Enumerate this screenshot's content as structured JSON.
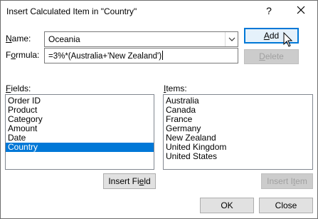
{
  "window": {
    "title": "Insert Calculated Item in \"Country\"",
    "help": "?"
  },
  "form": {
    "name_label_key": "N",
    "name_label_rest": "ame:",
    "name_value": "Oceania",
    "formula_label_pre": "F",
    "formula_label_key": "o",
    "formula_label_rest": "rmula:",
    "formula_value": "=3%*(Australia+'New Zealand')"
  },
  "fields": {
    "label_key": "F",
    "label_rest": "ields:",
    "items": [
      "Order ID",
      "Product",
      "Category",
      "Amount",
      "Date",
      "Country"
    ],
    "selected": "Country"
  },
  "items": {
    "label_key": "I",
    "label_rest": "tems:",
    "items": [
      "Australia",
      "Canada",
      "France",
      "Germany",
      "New Zealand",
      "United Kingdom",
      "United States"
    ]
  },
  "buttons": {
    "add_key": "A",
    "add_rest": "dd",
    "delete_key": "D",
    "delete_rest": "elete",
    "insert_field_pre": "Insert Fi",
    "insert_field_key": "e",
    "insert_field_rest": "ld",
    "insert_item_pre": "Insert I",
    "insert_item_key": "t",
    "insert_item_rest": "em",
    "ok": "OK",
    "close": "Close"
  },
  "colors": {
    "selection": "#0078d7",
    "default_button_border": "#0078d7",
    "disabled_text": "#a0a0a0"
  }
}
